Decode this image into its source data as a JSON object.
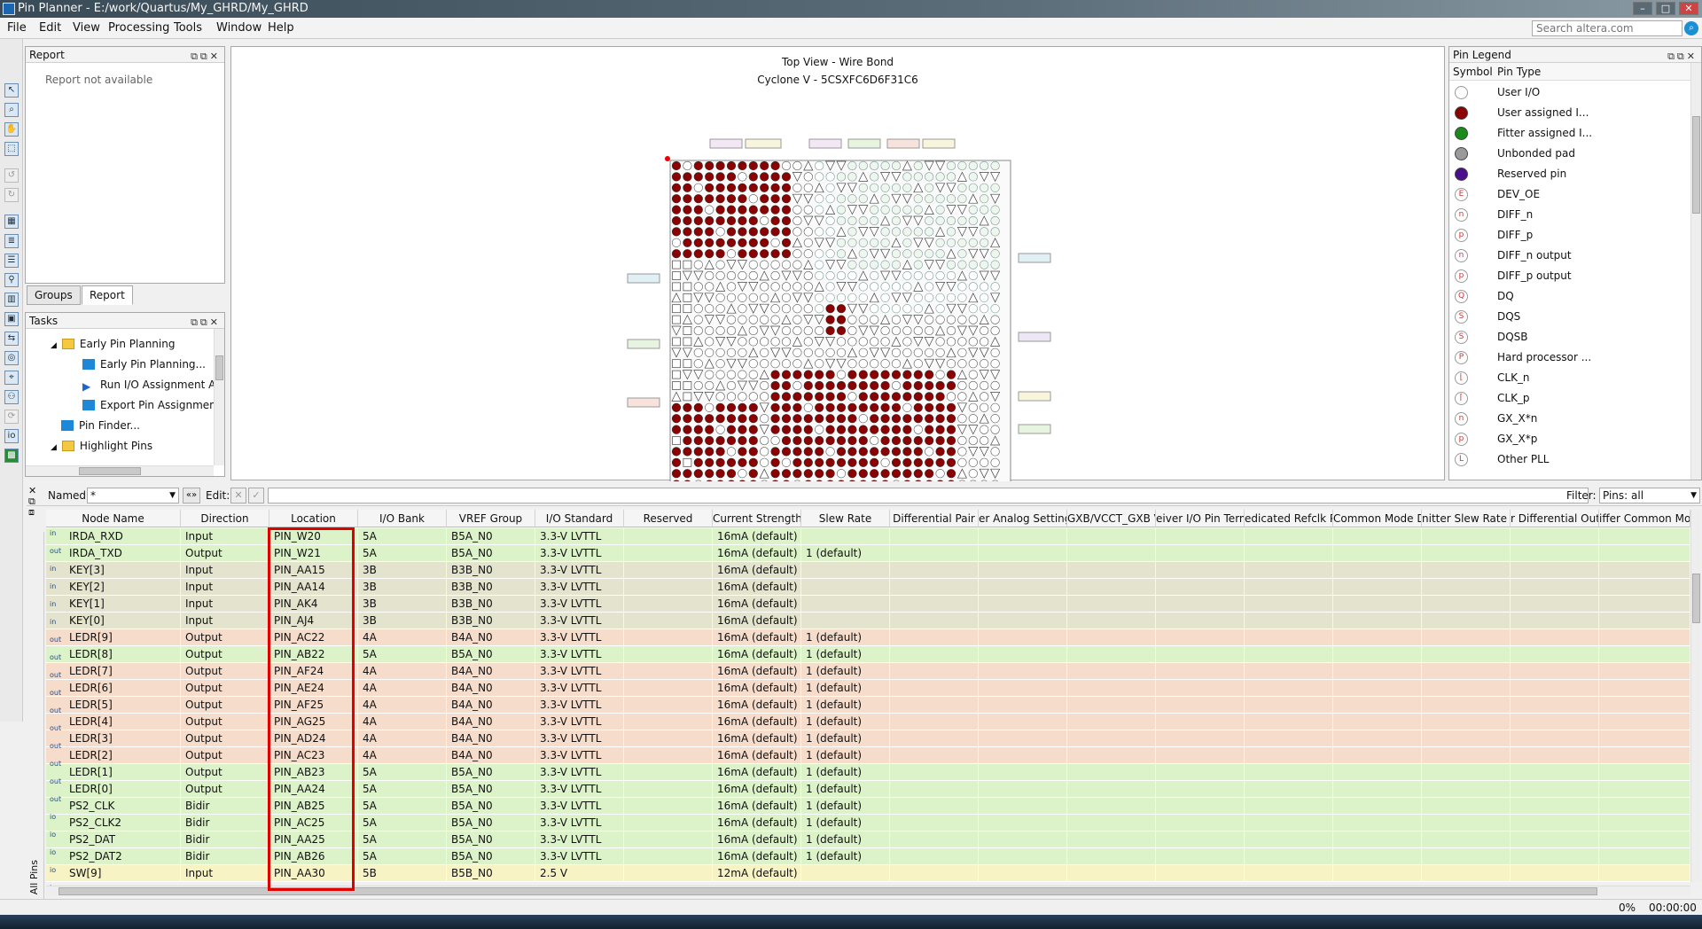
{
  "window": {
    "title": "Pin Planner - E:/work/Quartus/My_GHRD/My_GHRD"
  },
  "menu": [
    "File",
    "Edit",
    "View",
    "Processing",
    "Tools",
    "Window",
    "Help"
  ],
  "search": {
    "placeholder": "Search altera.com"
  },
  "report_panel": {
    "title": "Report",
    "message": "Report not available"
  },
  "side_tabs": [
    "Groups",
    "Report"
  ],
  "tasks_panel": {
    "title": "Tasks",
    "items": [
      "Early Pin Planning",
      "Early Pin Planning...",
      "Run I/O Assignment An",
      "Export Pin Assignment",
      "Pin Finder...",
      "Highlight Pins"
    ]
  },
  "chip_view": {
    "title": "Top View - Wire Bond",
    "device": "Cyclone V - 5CSXFC6D6F31C6"
  },
  "legend": {
    "title": "Pin Legend",
    "columns": [
      "Symbol",
      "Pin Type"
    ],
    "items": [
      {
        "label": "User I/O",
        "symbol": "",
        "color": "#ffffff"
      },
      {
        "label": "User assigned I...",
        "symbol": "",
        "color": "#8b0000"
      },
      {
        "label": "Fitter assigned I...",
        "symbol": "",
        "color": "#1a8a1a"
      },
      {
        "label": "Unbonded pad",
        "symbol": "",
        "color": "#9a9a9a"
      },
      {
        "label": "Reserved pin",
        "symbol": "",
        "color": "#4b0f8c"
      },
      {
        "label": "DEV_OE",
        "symbol": "E",
        "color": "#ffffff"
      },
      {
        "label": "DIFF_n",
        "symbol": "n",
        "color": "#ffffff"
      },
      {
        "label": "DIFF_p",
        "symbol": "p",
        "color": "#ffffff"
      },
      {
        "label": "DIFF_n output",
        "symbol": "n",
        "color": "#ffffff"
      },
      {
        "label": "DIFF_p output",
        "symbol": "p",
        "color": "#ffffff"
      },
      {
        "label": "DQ",
        "symbol": "Q",
        "color": "#ffffff"
      },
      {
        "label": "DQS",
        "symbol": "S",
        "color": "#ffffff"
      },
      {
        "label": "DQSB",
        "symbol": "S",
        "color": "#ffffff"
      },
      {
        "label": "Hard processor ...",
        "symbol": "P",
        "color": "#ffffff"
      },
      {
        "label": "CLK_n",
        "symbol": "⌊",
        "color": "#ffffff"
      },
      {
        "label": "CLK_p",
        "symbol": "⌈",
        "color": "#ffffff"
      },
      {
        "label": "GX_X*n",
        "symbol": "n",
        "color": "#ffffff"
      },
      {
        "label": "GX_X*p",
        "symbol": "p",
        "color": "#ffffff"
      },
      {
        "label": "Other PLL",
        "symbol": "L",
        "color": "#ffffff"
      }
    ]
  },
  "filter_bar": {
    "named_label": "Named:",
    "named_value": "*",
    "edit_label": "Edit:",
    "filter_label": "Filter:",
    "filter_value": "Pins: all"
  },
  "grid": {
    "side_label": "All Pins",
    "columns": [
      "Node Name",
      "Direction",
      "Location",
      "I/O Bank",
      "VREF Group",
      "I/O Standard",
      "Reserved",
      "Current Strength",
      "Slew Rate",
      "Differential Pair",
      "er Analog Settings",
      "GXB/VCCT_GXB V",
      "eiver I/O Pin Term",
      "edicated Refclk Pi",
      "Common Mode D",
      "nitter Slew Rate C",
      "r Differential Outp",
      "iffer Common Mo"
    ],
    "rows": [
      {
        "icon": "in",
        "node": "IRDA_RXD",
        "dir": "Input",
        "loc": "PIN_W20",
        "bank": "5A",
        "vref": "B5A_N0",
        "std": "3.3-V LVTTL",
        "cur": "16mA (default)",
        "slew": "",
        "color": "#dcf2c8"
      },
      {
        "icon": "out",
        "node": "IRDA_TXD",
        "dir": "Output",
        "loc": "PIN_W21",
        "bank": "5A",
        "vref": "B5A_N0",
        "std": "3.3-V LVTTL",
        "cur": "16mA (default)",
        "slew": "1 (default)",
        "color": "#dcf2c8"
      },
      {
        "icon": "in",
        "node": "KEY[3]",
        "dir": "Input",
        "loc": "PIN_AA15",
        "bank": "3B",
        "vref": "B3B_N0",
        "std": "3.3-V LVTTL",
        "cur": "16mA (default)",
        "slew": "",
        "color": "#e4e3cd"
      },
      {
        "icon": "in",
        "node": "KEY[2]",
        "dir": "Input",
        "loc": "PIN_AA14",
        "bank": "3B",
        "vref": "B3B_N0",
        "std": "3.3-V LVTTL",
        "cur": "16mA (default)",
        "slew": "",
        "color": "#e4e3cd"
      },
      {
        "icon": "in",
        "node": "KEY[1]",
        "dir": "Input",
        "loc": "PIN_AK4",
        "bank": "3B",
        "vref": "B3B_N0",
        "std": "3.3-V LVTTL",
        "cur": "16mA (default)",
        "slew": "",
        "color": "#e4e3cd"
      },
      {
        "icon": "in",
        "node": "KEY[0]",
        "dir": "Input",
        "loc": "PIN_AJ4",
        "bank": "3B",
        "vref": "B3B_N0",
        "std": "3.3-V LVTTL",
        "cur": "16mA (default)",
        "slew": "",
        "color": "#e4e3cd"
      },
      {
        "icon": "out",
        "node": "LEDR[9]",
        "dir": "Output",
        "loc": "PIN_AC22",
        "bank": "4A",
        "vref": "B4A_N0",
        "std": "3.3-V LVTTL",
        "cur": "16mA (default)",
        "slew": "1 (default)",
        "color": "#f6dccb"
      },
      {
        "icon": "out",
        "node": "LEDR[8]",
        "dir": "Output",
        "loc": "PIN_AB22",
        "bank": "5A",
        "vref": "B5A_N0",
        "std": "3.3-V LVTTL",
        "cur": "16mA (default)",
        "slew": "1 (default)",
        "color": "#dcf2c8"
      },
      {
        "icon": "out",
        "node": "LEDR[7]",
        "dir": "Output",
        "loc": "PIN_AF24",
        "bank": "4A",
        "vref": "B4A_N0",
        "std": "3.3-V LVTTL",
        "cur": "16mA (default)",
        "slew": "1 (default)",
        "color": "#f6dccb"
      },
      {
        "icon": "out",
        "node": "LEDR[6]",
        "dir": "Output",
        "loc": "PIN_AE24",
        "bank": "4A",
        "vref": "B4A_N0",
        "std": "3.3-V LVTTL",
        "cur": "16mA (default)",
        "slew": "1 (default)",
        "color": "#f6dccb"
      },
      {
        "icon": "out",
        "node": "LEDR[5]",
        "dir": "Output",
        "loc": "PIN_AF25",
        "bank": "4A",
        "vref": "B4A_N0",
        "std": "3.3-V LVTTL",
        "cur": "16mA (default)",
        "slew": "1 (default)",
        "color": "#f6dccb"
      },
      {
        "icon": "out",
        "node": "LEDR[4]",
        "dir": "Output",
        "loc": "PIN_AG25",
        "bank": "4A",
        "vref": "B4A_N0",
        "std": "3.3-V LVTTL",
        "cur": "16mA (default)",
        "slew": "1 (default)",
        "color": "#f6dccb"
      },
      {
        "icon": "out",
        "node": "LEDR[3]",
        "dir": "Output",
        "loc": "PIN_AD24",
        "bank": "4A",
        "vref": "B4A_N0",
        "std": "3.3-V LVTTL",
        "cur": "16mA (default)",
        "slew": "1 (default)",
        "color": "#f6dccb"
      },
      {
        "icon": "out",
        "node": "LEDR[2]",
        "dir": "Output",
        "loc": "PIN_AC23",
        "bank": "4A",
        "vref": "B4A_N0",
        "std": "3.3-V LVTTL",
        "cur": "16mA (default)",
        "slew": "1 (default)",
        "color": "#f6dccb"
      },
      {
        "icon": "out",
        "node": "LEDR[1]",
        "dir": "Output",
        "loc": "PIN_AB23",
        "bank": "5A",
        "vref": "B5A_N0",
        "std": "3.3-V LVTTL",
        "cur": "16mA (default)",
        "slew": "1 (default)",
        "color": "#dcf2c8"
      },
      {
        "icon": "out",
        "node": "LEDR[0]",
        "dir": "Output",
        "loc": "PIN_AA24",
        "bank": "5A",
        "vref": "B5A_N0",
        "std": "3.3-V LVTTL",
        "cur": "16mA (default)",
        "slew": "1 (default)",
        "color": "#dcf2c8"
      },
      {
        "icon": "io",
        "node": "PS2_CLK",
        "dir": "Bidir",
        "loc": "PIN_AB25",
        "bank": "5A",
        "vref": "B5A_N0",
        "std": "3.3-V LVTTL",
        "cur": "16mA (default)",
        "slew": "1 (default)",
        "color": "#dcf2c8"
      },
      {
        "icon": "io",
        "node": "PS2_CLK2",
        "dir": "Bidir",
        "loc": "PIN_AC25",
        "bank": "5A",
        "vref": "B5A_N0",
        "std": "3.3-V LVTTL",
        "cur": "16mA (default)",
        "slew": "1 (default)",
        "color": "#dcf2c8"
      },
      {
        "icon": "io",
        "node": "PS2_DAT",
        "dir": "Bidir",
        "loc": "PIN_AA25",
        "bank": "5A",
        "vref": "B5A_N0",
        "std": "3.3-V LVTTL",
        "cur": "16mA (default)",
        "slew": "1 (default)",
        "color": "#dcf2c8"
      },
      {
        "icon": "io",
        "node": "PS2_DAT2",
        "dir": "Bidir",
        "loc": "PIN_AB26",
        "bank": "5A",
        "vref": "B5A_N0",
        "std": "3.3-V LVTTL",
        "cur": "16mA (default)",
        "slew": "1 (default)",
        "color": "#dcf2c8"
      },
      {
        "icon": "in",
        "node": "SW[9]",
        "dir": "Input",
        "loc": "PIN_AA30",
        "bank": "5B",
        "vref": "B5B_N0",
        "std": "2.5 V",
        "cur": "12mA (default)",
        "slew": "",
        "color": "#f7f3c4"
      }
    ]
  },
  "status": {
    "progress": "0%",
    "time": "00:00:00"
  },
  "colors": {
    "highlight_box": "#e00000",
    "user_assigned": "#8b0000"
  }
}
